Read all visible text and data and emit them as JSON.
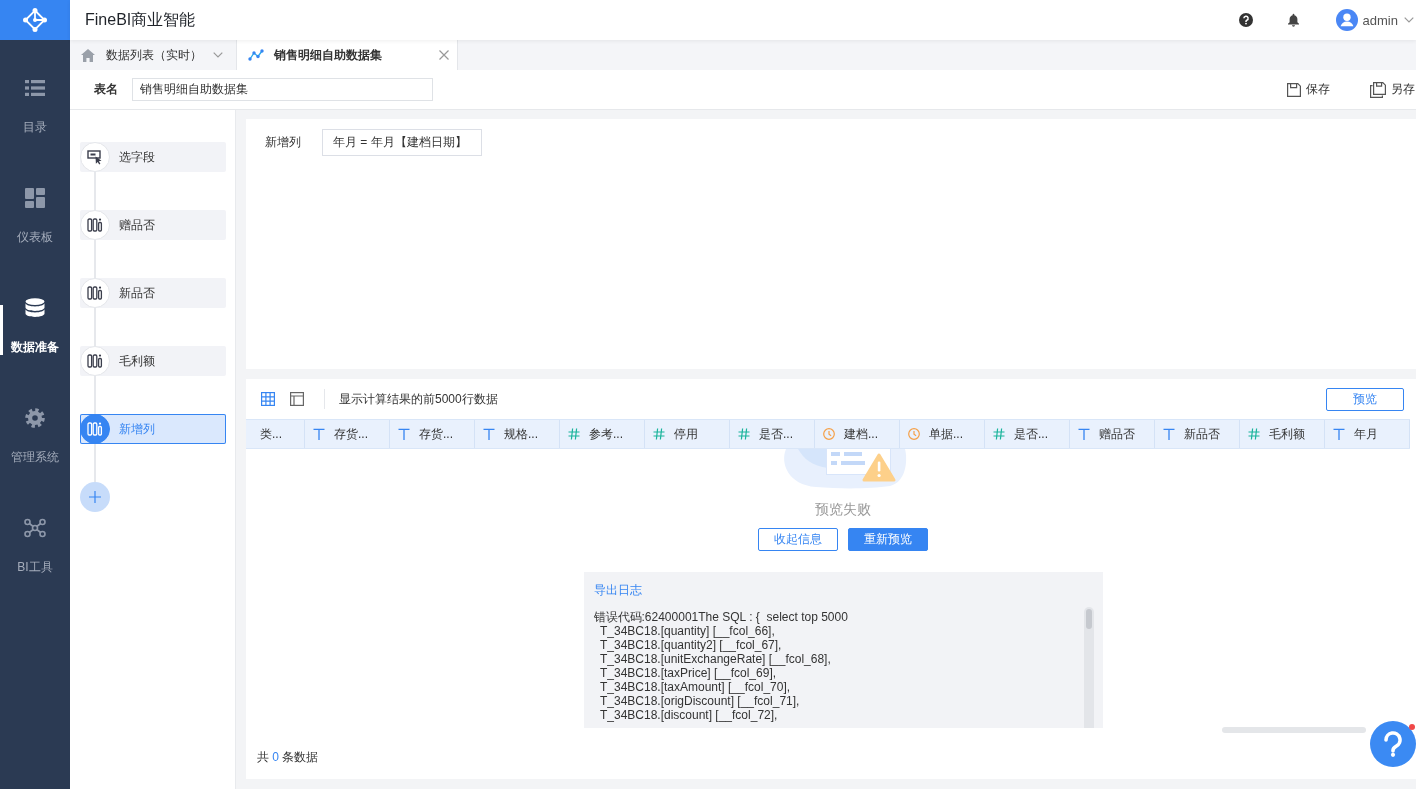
{
  "app": {
    "title": "FineBI商业智能",
    "user": "admin"
  },
  "nav": [
    {
      "label": "目录",
      "kind": "catalog",
      "selected": false
    },
    {
      "label": "仪表板",
      "kind": "dashboard",
      "selected": false
    },
    {
      "label": "数据准备",
      "kind": "data",
      "selected": true
    },
    {
      "label": "管理系统",
      "kind": "settings",
      "selected": false
    },
    {
      "label": "BI工具",
      "kind": "tools",
      "selected": false
    }
  ],
  "tabs": [
    {
      "label": "数据列表（实时）",
      "kind": "home",
      "selected": false
    },
    {
      "label": "销售明细自助数据集",
      "kind": "dataset",
      "selected": true
    }
  ],
  "table_name": {
    "label": "表名",
    "value": "销售明细自助数据集"
  },
  "actions": [
    {
      "label": "保存",
      "kind": "save"
    },
    {
      "label": "另存",
      "kind": "save-as"
    }
  ],
  "steps": [
    {
      "label": "选字段",
      "kind": "select",
      "selected": false
    },
    {
      "label": "赠品否",
      "kind": "column",
      "selected": false
    },
    {
      "label": "新品否",
      "kind": "column",
      "selected": false
    },
    {
      "label": "毛利额",
      "kind": "column",
      "selected": false
    },
    {
      "label": "新增列",
      "kind": "column",
      "selected": true
    }
  ],
  "formula": {
    "label": "新增列",
    "value": "年月 = 年月【建档日期】"
  },
  "preview": {
    "view_modes": [
      {
        "kind": "grid",
        "selected": true
      },
      {
        "kind": "layout",
        "selected": false
      }
    ],
    "note": "显示计算结果的前5000行数据",
    "button": "预览",
    "columns": [
      {
        "label": "类...",
        "kind": "plain"
      },
      {
        "label": "存货...",
        "kind": "text"
      },
      {
        "label": "存货...",
        "kind": "text"
      },
      {
        "label": "规格...",
        "kind": "text"
      },
      {
        "label": "参考...",
        "kind": "number"
      },
      {
        "label": "停用",
        "kind": "number"
      },
      {
        "label": "是否...",
        "kind": "number"
      },
      {
        "label": "建档...",
        "kind": "date"
      },
      {
        "label": "单据...",
        "kind": "date"
      },
      {
        "label": "是否...",
        "kind": "number"
      },
      {
        "label": "赠品否",
        "kind": "text"
      },
      {
        "label": "新品否",
        "kind": "text"
      },
      {
        "label": "毛利额",
        "kind": "number"
      },
      {
        "label": "年月",
        "kind": "text"
      }
    ],
    "error": {
      "message": "预览失败",
      "buttons": [
        {
          "label": "收起信息",
          "kind": "secondary"
        },
        {
          "label": "重新预览",
          "kind": "primary"
        }
      ],
      "log_link": "导出日志",
      "log_lines": [
        "错误代码:62400001The SQL : {  select top 5000",
        "  T_34BC18.[quantity] [__fcol_66],",
        "  T_34BC18.[quantity2] [__fcol_67],",
        "  T_34BC18.[unitExchangeRate] [__fcol_68],",
        "  T_34BC18.[taxPrice] [__fcol_69],",
        "  T_34BC18.[taxAmount] [__fcol_70],",
        "  T_34BC18.[origDiscount] [__fcol_71],",
        "  T_34BC18.[discount] [__fcol_72],"
      ]
    },
    "footer": {
      "prefix": "共",
      "count": "0",
      "suffix": "条数据"
    }
  },
  "help": {
    "has_notification": true
  }
}
